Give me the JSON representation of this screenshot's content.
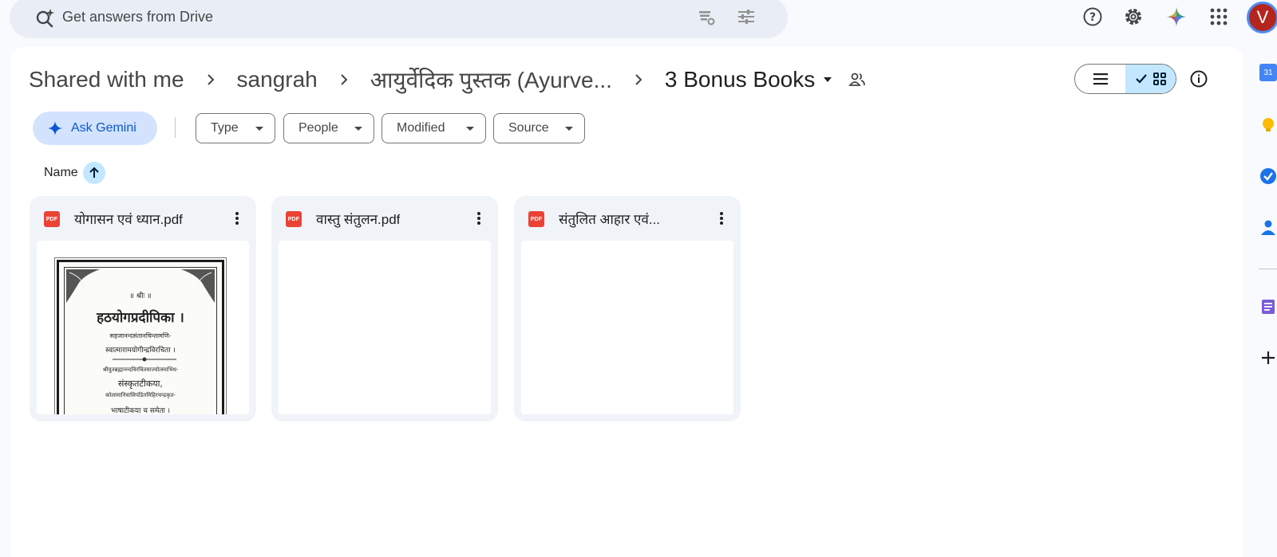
{
  "search": {
    "placeholder": "Get answers from Drive"
  },
  "account": {
    "initial": "V"
  },
  "breadcrumb": {
    "items": [
      "Shared with me",
      "sangrah",
      "आयुर्वेदिक पुस्तक (Ayurve..."
    ],
    "current": "3 Bonus Books"
  },
  "actions": {
    "ask_gemini": "Ask Gemini"
  },
  "filters": [
    {
      "label": "Type"
    },
    {
      "label": "People"
    },
    {
      "label": "Modified"
    },
    {
      "label": "Source"
    }
  ],
  "sort": {
    "label": "Name",
    "direction": "ascending"
  },
  "files": [
    {
      "name": "योगासन एवं ध्यान.pdf",
      "type_badge": "PDF",
      "has_preview": true
    },
    {
      "name": "वास्तु संतुलन.pdf",
      "type_badge": "PDF",
      "has_preview": false
    },
    {
      "name": "संतुलित आहार एवं...",
      "type_badge": "PDF",
      "has_preview": false
    }
  ],
  "preview_cover": {
    "lines": [
      "॥ श्रीः ॥",
      "हठयोगप्रदीपिका ।",
      "सहजानन्दसंतानचिन्तामणि-",
      "स्वात्मारामयोगीन्द्रविरचिता ।",
      "श्रीयुतब्रह्मानन्दविरचितयाज्योत्स्नाभिध-",
      "संस्कृतटीकया,",
      "कोलामानिवासिपंडितमिहिरचन्द्रकृत-",
      "भाषाटीकया च समेता ।"
    ]
  },
  "colors": {
    "accent_blue": "#0b57d0",
    "selected_chip": "#c2e7ff",
    "pdf_red": "#ea4335",
    "avatar": "#b3261e"
  },
  "side_rail": {
    "calendar_day": "31",
    "icons": [
      "calendar-icon",
      "keep-icon",
      "tasks-icon",
      "contacts-icon",
      "notes-icon",
      "add-icon"
    ]
  }
}
